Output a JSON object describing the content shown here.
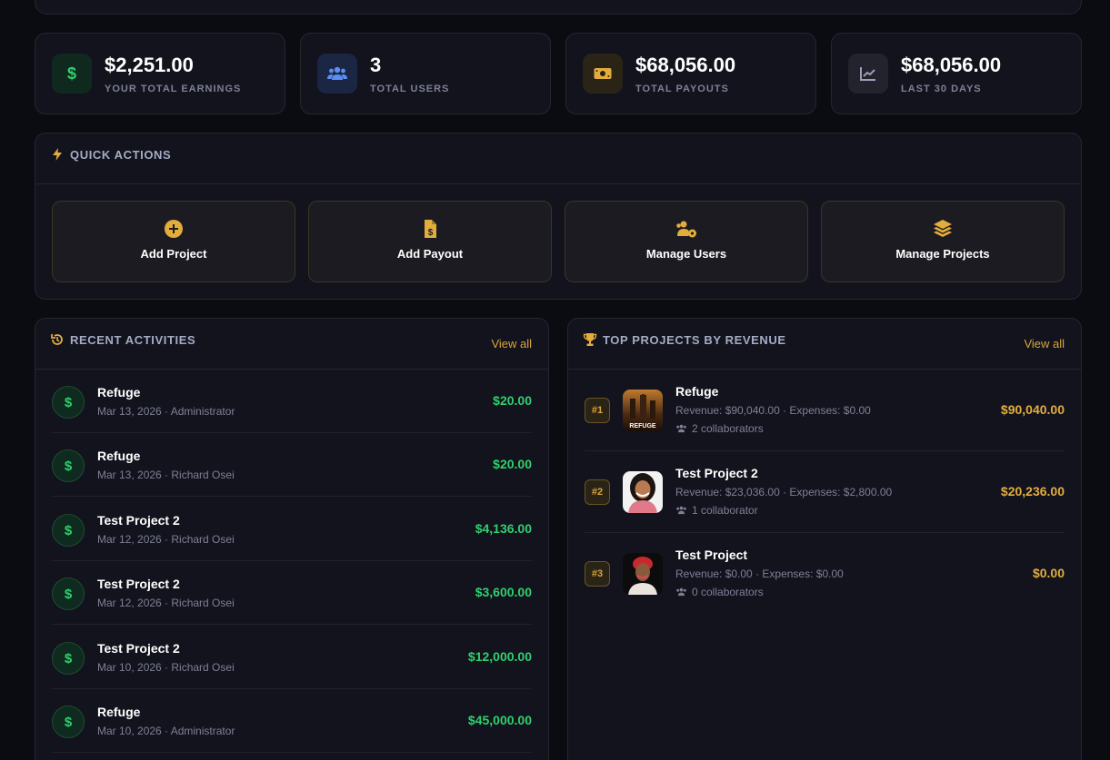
{
  "stats": [
    {
      "value": "$2,251.00",
      "label": "YOUR TOTAL EARNINGS",
      "icon": "dollar-icon",
      "icon_color": "#2fd06d",
      "icon_bg": "#10291e"
    },
    {
      "value": "3",
      "label": "TOTAL USERS",
      "icon": "users-icon",
      "icon_color": "#5b8ef0",
      "icon_bg": "#1a2644"
    },
    {
      "value": "$68,056.00",
      "label": "TOTAL PAYOUTS",
      "icon": "money-icon",
      "icon_color": "#e3ad3d",
      "icon_bg": "#2a2417"
    },
    {
      "value": "$68,056.00",
      "label": "LAST 30 DAYS",
      "icon": "chart-line-icon",
      "icon_color": "#9aa0b8",
      "icon_bg": "#23232e"
    }
  ],
  "quick_actions": {
    "title": "QUICK ACTIONS",
    "buttons": [
      {
        "label": "Add Project",
        "icon": "plus-circle-icon"
      },
      {
        "label": "Add Payout",
        "icon": "file-invoice-dollar-icon"
      },
      {
        "label": "Manage Users",
        "icon": "users-cog-icon"
      },
      {
        "label": "Manage Projects",
        "icon": "layers-icon"
      }
    ]
  },
  "recent_activities": {
    "title": "RECENT ACTIVITIES",
    "view_all": "View all",
    "items": [
      {
        "name": "Refuge",
        "meta": "Mar 13, 2026 · Administrator",
        "amount": "$20.00"
      },
      {
        "name": "Refuge",
        "meta": "Mar 13, 2026 · Richard Osei",
        "amount": "$20.00"
      },
      {
        "name": "Test Project 2",
        "meta": "Mar 12, 2026 · Richard Osei",
        "amount": "$4,136.00"
      },
      {
        "name": "Test Project 2",
        "meta": "Mar 12, 2026 · Richard Osei",
        "amount": "$3,600.00"
      },
      {
        "name": "Test Project 2",
        "meta": "Mar 10, 2026 · Richard Osei",
        "amount": "$12,000.00"
      },
      {
        "name": "Refuge",
        "meta": "Mar 10, 2026 · Administrator",
        "amount": "$45,000.00"
      }
    ]
  },
  "top_projects": {
    "title": "TOP PROJECTS BY REVENUE",
    "view_all": "View all",
    "items": [
      {
        "rank": "#1",
        "name": "Refuge",
        "meta": "Revenue: $90,040.00 · Expenses: $0.00",
        "collaborators": "2 collaborators",
        "amount": "$90,040.00",
        "thumb_text": "REFUGE"
      },
      {
        "rank": "#2",
        "name": "Test Project 2",
        "meta": "Revenue: $23,036.00 · Expenses: $2,800.00",
        "collaborators": "1 collaborator",
        "amount": "$20,236.00"
      },
      {
        "rank": "#3",
        "name": "Test Project",
        "meta": "Revenue: $0.00 · Expenses: $0.00",
        "collaborators": "0 collaborators",
        "amount": "$0.00"
      }
    ]
  }
}
